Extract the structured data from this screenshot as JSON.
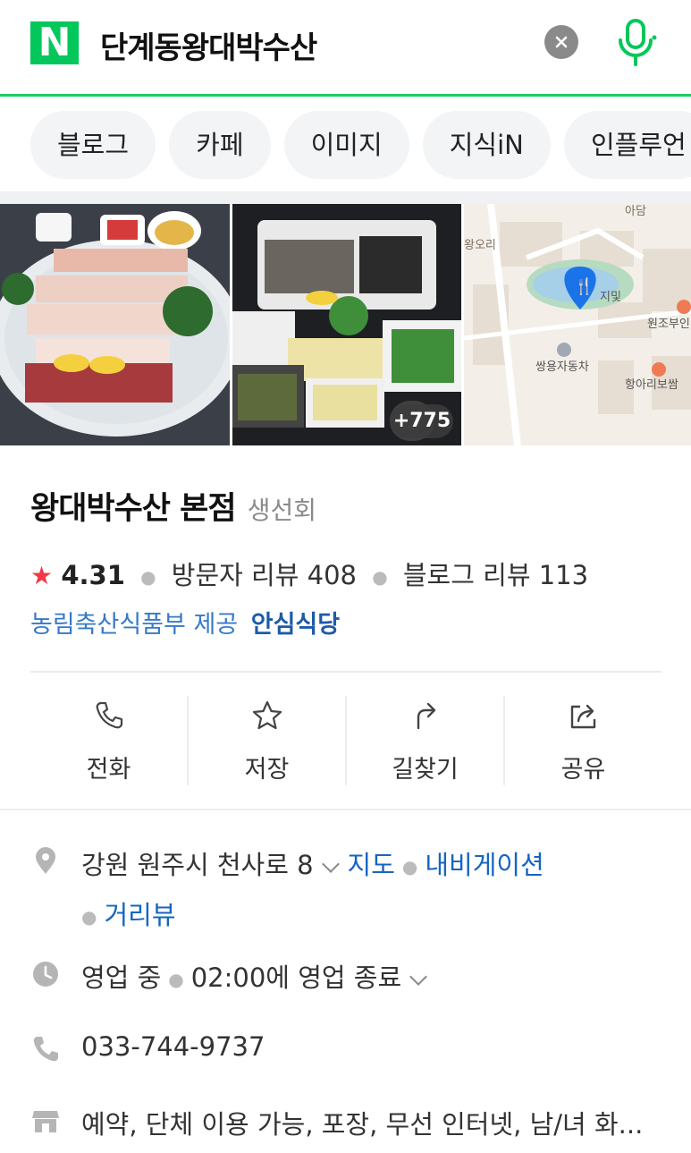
{
  "search": {
    "logo": "N",
    "query": "단계동왕대박수산",
    "clear_icon": "close-icon",
    "mic_icon": "microphone-icon",
    "accent": "#03c75a"
  },
  "tabs": [
    {
      "label": "블로그"
    },
    {
      "label": "카페"
    },
    {
      "label": "이미지"
    },
    {
      "label": "지식iN"
    },
    {
      "label": "인플루언"
    }
  ],
  "photos": {
    "more_count": "+775",
    "map_labels": [
      "아담",
      "왕오리",
      "지및",
      "원조부인",
      "쌍용자동차",
      "항아리보쌈"
    ]
  },
  "place": {
    "name": "왕대박수산 본점",
    "category": "생선회",
    "rating": "4.31",
    "visitor_reviews": "방문자 리뷰 408",
    "blog_reviews": "블로그 리뷰 113",
    "certification": "농림축산식품부 제공",
    "certification_badge": "안심식당"
  },
  "actions": [
    {
      "label": "전화",
      "icon": "phone-icon"
    },
    {
      "label": "저장",
      "icon": "star-icon"
    },
    {
      "label": "길찾기",
      "icon": "directions-icon"
    },
    {
      "label": "공유",
      "icon": "share-icon"
    }
  ],
  "info": {
    "address": "강원 원주시 천사로 8",
    "map_link": "지도",
    "nav_link": "내비게이션",
    "street_link": "거리뷰",
    "status": "영업 중",
    "hours": "02:00에 영업 종료",
    "phone": "033-744-9737",
    "amenities": "예약, 단체 이용 가능, 포장, 무선 인터넷, 남/녀 화..."
  }
}
